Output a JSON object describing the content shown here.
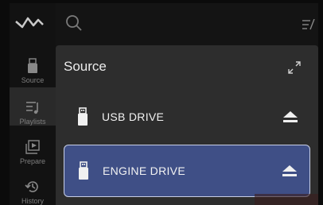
{
  "sidebar": {
    "items": [
      {
        "label": "Source",
        "icon": "usb-drive-icon"
      },
      {
        "label": "Playlists",
        "icon": "playlist-icon"
      },
      {
        "label": "Prepare",
        "icon": "prepare-icon"
      },
      {
        "label": "History",
        "icon": "history-icon"
      }
    ]
  },
  "topbar": {
    "search_icon": "search-icon",
    "menu_icon": "edit-list-icon"
  },
  "panel": {
    "title": "Source",
    "sources": [
      {
        "label": "USB DRIVE",
        "selected": false
      },
      {
        "label": "ENGINE DRIVE",
        "selected": true
      }
    ]
  },
  "colors": {
    "selected_row": "#3f4f86",
    "panel_bg": "#2d2d2d",
    "sidebar_bg": "#121212"
  }
}
